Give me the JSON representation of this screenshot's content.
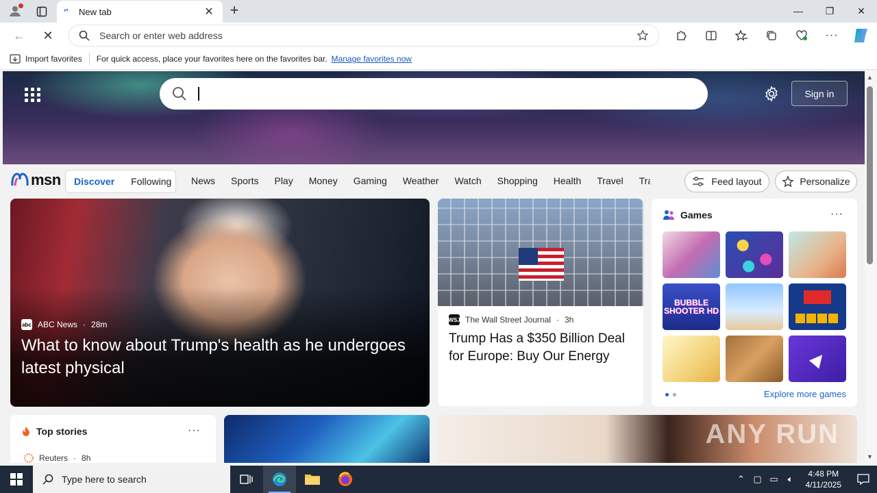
{
  "browser": {
    "tab_title": "New tab",
    "address_placeholder": "Search or enter web address",
    "favorites_bar": {
      "import_label": "Import favorites",
      "hint": "For quick access, place your favorites here on the favorites bar.",
      "manage_link": "Manage favorites now"
    }
  },
  "hero": {
    "search_value": "",
    "signin_label": "Sign in"
  },
  "msn": {
    "logo_text": "msn",
    "feed_tabs": [
      "Discover",
      "Following"
    ],
    "active_tab": "Discover",
    "nav_links": [
      "News",
      "Sports",
      "Play",
      "Money",
      "Gaming",
      "Weather",
      "Watch",
      "Shopping",
      "Health",
      "Travel",
      "Trai"
    ],
    "feed_layout_label": "Feed layout",
    "personalize_label": "Personalize"
  },
  "cards": {
    "main": {
      "source": "ABC News",
      "source_logo": "abc",
      "age": "28m",
      "headline": "What to know about Trump's health as he undergoes latest physical"
    },
    "wsj": {
      "source": "The Wall Street Journal",
      "source_logo": "WSJ",
      "age": "3h",
      "headline": "Trump Has a $350 Billion Deal for Europe: Buy Our Energy"
    },
    "games": {
      "title": "Games",
      "explore_label": "Explore more games",
      "tile_text": "BUBBLE SHOOTER HD"
    },
    "top_stories": {
      "title": "Top stories",
      "source": "Reuters",
      "age": "8h"
    },
    "watermark": "ANY RUN"
  },
  "taskbar": {
    "search_placeholder": "Type here to search",
    "time": "4:48 PM",
    "date": "4/11/2025"
  },
  "colors": {
    "accent": "#1a64c8",
    "taskbar": "#1f2a3a",
    "titlebar": "#dfe3e8"
  }
}
